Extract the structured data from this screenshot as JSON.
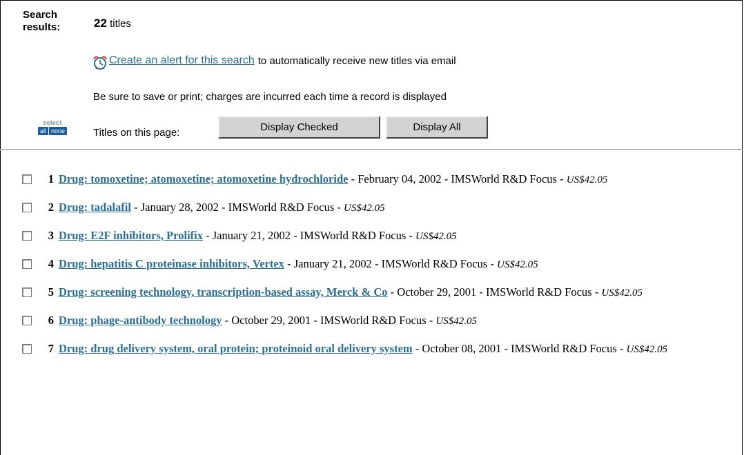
{
  "header": {
    "search_label_line1": "Search",
    "search_label_line2": "results:",
    "count": "22",
    "count_suffix": "titles",
    "alert_link": "Create an alert for this search",
    "alert_tail": "to automatically receive new titles via email",
    "warning": "Be sure to save or print; charges are incurred each time a record is displayed",
    "select_word": "select",
    "select_all": "all",
    "select_none": "none",
    "titles_label": "Titles on this page:",
    "display_checked": "Display Checked",
    "display_all": "Display All",
    "icons": {
      "alert": "alarm-clock-icon"
    },
    "colors": {
      "link": "#2a6f93",
      "select_btn": "#1d5c9a",
      "button_bg": "#d3d3d3"
    }
  },
  "results": [
    {
      "num": "1",
      "title": "Drug: tomoxetine; atomoxetine; atomoxetine hydrochloride",
      "meta": " - February 04, 2002 - IMSWorld R&D Focus - ",
      "price": "US$42.05"
    },
    {
      "num": "2",
      "title": "Drug: tadalafil",
      "meta": " - January 28, 2002 - IMSWorld R&D Focus - ",
      "price": "US$42.05"
    },
    {
      "num": "3",
      "title": "Drug: E2F inhibitors, Prolifix",
      "meta": " - January 21, 2002 - IMSWorld R&D Focus - ",
      "price": "US$42.05"
    },
    {
      "num": "4",
      "title": "Drug: hepatitis C proteinase inhibitors, Vertex",
      "meta": " - January 21, 2002 - IMSWorld R&D Focus - ",
      "price": "US$42.05"
    },
    {
      "num": "5",
      "title": "Drug: screening technology, transcription-based assay, Merck & Co",
      "meta": " - October 29, 2001 - IMSWorld R&D Focus - ",
      "price": "US$42.05"
    },
    {
      "num": "6",
      "title": "Drug: phage-antibody technology",
      "meta": " - October 29, 2001 - IMSWorld R&D Focus - ",
      "price": "US$42.05"
    },
    {
      "num": "7",
      "title": "Drug: drug delivery system, oral protein; proteinoid oral delivery system",
      "meta": " - October 08, 2001 - IMSWorld R&D Focus - ",
      "price": "US$42.05"
    }
  ]
}
